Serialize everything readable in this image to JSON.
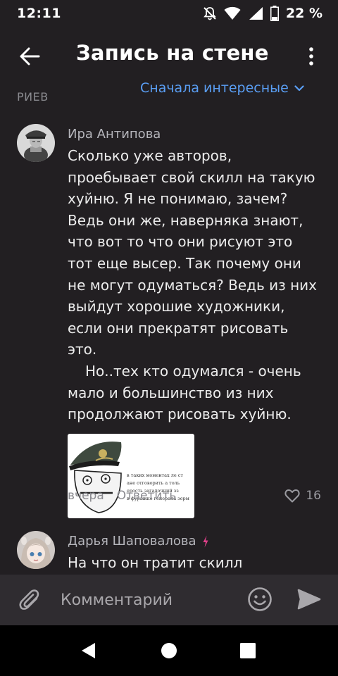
{
  "status_bar": {
    "time": "12:11",
    "battery": "22 %",
    "icons": [
      "mute-icon",
      "wifi-icon",
      "signal-icon",
      "battery-icon"
    ]
  },
  "header": {
    "title": "Запись на стене",
    "back_icon": "arrow-left-icon",
    "more_icon": "more-vertical-icon"
  },
  "sort": {
    "count_label_partial": "РИЕВ",
    "sort_label": "Сначала интересные"
  },
  "comments": [
    {
      "author": "Ира Антипова",
      "paragraphs": [
        "Сколько уже авторов, проебывает свой скилл на такую хуйню. Я не понимаю, зачем? Ведь они же, наверняка знают, что вот то что они рисуют это тот еще высер. Так почему они не могут одуматься? Ведь из них выйдут хорошие художники, если они прекратят рисовать это.",
        "Но..тех кто одумался - очень мало и большинство из них продолжают рисовать хуйню."
      ],
      "attachment_text": [
        "в таких моментах ле ст",
        "ане отговорить а толь",
        "ерость загадочний зз",
        "в  фуражке генерала зерм"
      ],
      "time": "вчера",
      "reply_label": "Ответить",
      "likes": "16"
    },
    {
      "author": "Дарья Шаповалова",
      "text": "На что он тратит скилл",
      "badge_icon": "lightning-icon"
    }
  ],
  "composer": {
    "placeholder": "Комментарий"
  },
  "colors": {
    "background": "#221f22",
    "accent_blue": "#5a9ef4",
    "muted_text": "#8a8a8f",
    "badge_pink": "#e0408a"
  }
}
